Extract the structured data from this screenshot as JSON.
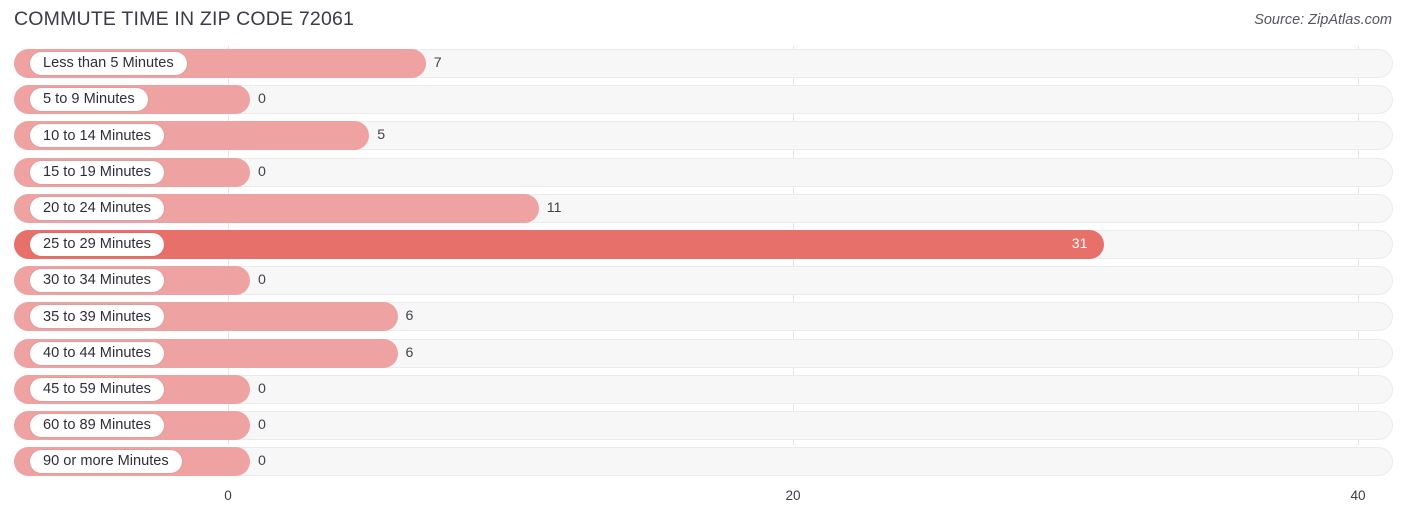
{
  "header": {
    "title": "COMMUTE TIME IN ZIP CODE 72061",
    "source": "Source: ZipAtlas.com"
  },
  "colors": {
    "bar_light": "#eea2a2",
    "bar_highlight": "#e8706a",
    "track": "#f7f7f7",
    "track_border": "#ebebeb",
    "gridline": "#e4e4e4",
    "label_text": "#2f2f38",
    "title_text": "#3b3b48"
  },
  "chart_data": {
    "type": "bar",
    "orientation": "horizontal",
    "title": "COMMUTE TIME IN ZIP CODE 72061",
    "xlabel": "",
    "ylabel": "",
    "xlim": [
      0,
      40
    ],
    "grid": true,
    "legend": null,
    "tick_labels": [
      "0",
      "20",
      "40"
    ],
    "ticks": [
      0,
      20,
      40
    ],
    "categories": [
      "Less than 5 Minutes",
      "5 to 9 Minutes",
      "10 to 14 Minutes",
      "15 to 19 Minutes",
      "20 to 24 Minutes",
      "25 to 29 Minutes",
      "30 to 34 Minutes",
      "35 to 39 Minutes",
      "40 to 44 Minutes",
      "45 to 59 Minutes",
      "60 to 89 Minutes",
      "90 or more Minutes"
    ],
    "values": [
      7,
      0,
      5,
      0,
      11,
      31,
      0,
      6,
      6,
      0,
      0,
      0
    ],
    "value_labels": [
      "7",
      "0",
      "5",
      "0",
      "11",
      "31",
      "0",
      "6",
      "6",
      "0",
      "0",
      "0"
    ],
    "highlight_index": 5
  }
}
